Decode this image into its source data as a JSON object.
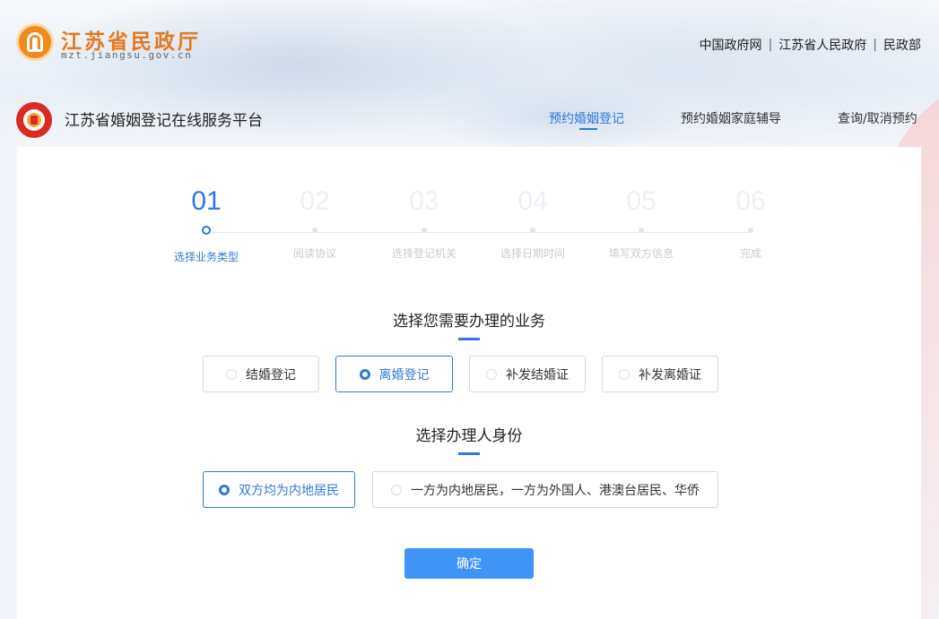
{
  "header": {
    "ministry_name": "江苏省民政厅",
    "ministry_url": "mzt.jiangsu.gov.cn",
    "links": [
      "中国政府网",
      "江苏省人民政府",
      "民政部"
    ]
  },
  "platform": {
    "title": "江苏省婚姻登记在线服务平台",
    "nav": [
      {
        "label": "预约婚姻登记",
        "active": true
      },
      {
        "label": "预约婚姻家庭辅导",
        "active": false
      },
      {
        "label": "查询/取消预约",
        "active": false
      }
    ]
  },
  "steps": [
    {
      "num": "01",
      "label": "选择业务类型",
      "active": true
    },
    {
      "num": "02",
      "label": "阅读协议",
      "active": false
    },
    {
      "num": "03",
      "label": "选择登记机关",
      "active": false
    },
    {
      "num": "04",
      "label": "选择日期时间",
      "active": false
    },
    {
      "num": "05",
      "label": "填写双方信息",
      "active": false
    },
    {
      "num": "06",
      "label": "完成",
      "active": false
    }
  ],
  "business": {
    "title": "选择您需要办理的业务",
    "options": [
      {
        "label": "结婚登记",
        "selected": false
      },
      {
        "label": "离婚登记",
        "selected": true
      },
      {
        "label": "补发结婚证",
        "selected": false
      },
      {
        "label": "补发离婚证",
        "selected": false
      }
    ]
  },
  "identity": {
    "title": "选择办理人身份",
    "options": [
      {
        "label": "双方均为内地居民",
        "selected": true
      },
      {
        "label": "一方为内地居民，一方为外国人、港澳台居民、华侨",
        "selected": false
      }
    ]
  },
  "confirm_label": "确定",
  "colors": {
    "accent": "#2f7ad8",
    "button": "#3f95f5",
    "ministry_orange": "#e8761a",
    "platform_red": "#d92b22"
  }
}
